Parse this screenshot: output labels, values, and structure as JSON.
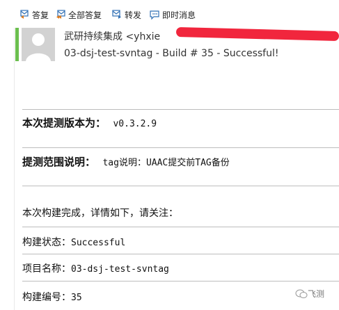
{
  "toolbar": {
    "reply": "答复",
    "reply_all": "全部答复",
    "forward": "转发",
    "im": "即时消息"
  },
  "email": {
    "sender": "武研持续集成 <yhxie",
    "subject": "03-dsj-test-svntag - Build # 35 - Successful!"
  },
  "content": {
    "version_label": "本次提测版本为：",
    "version_value": "v0.3.2.9",
    "scope_label": "提测范围说明：",
    "scope_value": "tag说明：UAAC提交前TAG备份",
    "build_notice": "本次构建完成，详情如下，请关注：",
    "status_label": "构建状态：",
    "status_value": "Successful",
    "project_label": "项目名称：",
    "project_value": "03-dsj-test-svntag",
    "build_no_label": "构建编号：",
    "build_no_value": "35"
  },
  "watermark": {
    "text": "飞测"
  },
  "colors": {
    "accent": "#6bbf4e",
    "redaction": "#f0142c",
    "icon_blue": "#2f6fb3"
  }
}
